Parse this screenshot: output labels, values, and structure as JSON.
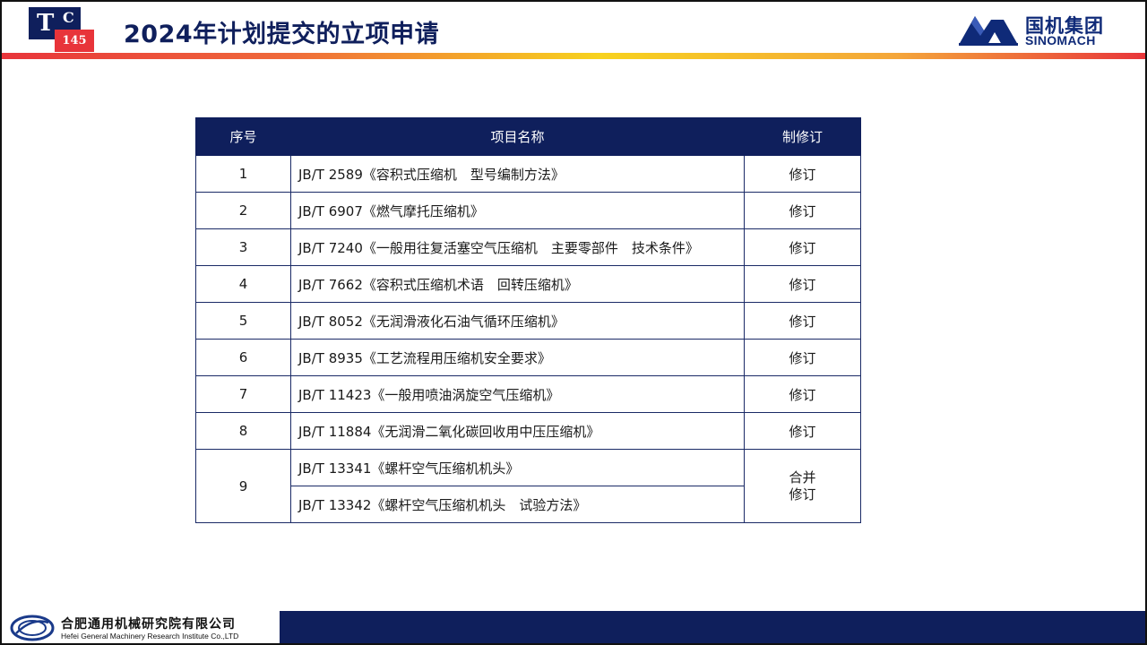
{
  "header": {
    "logo": {
      "t": "T",
      "c": "C",
      "number": "145"
    },
    "title": "2024年计划提交的立项申请",
    "brand": {
      "name_cn": "国机集团",
      "name_en": "SINOMACH"
    }
  },
  "table": {
    "headers": [
      "序号",
      "项目名称",
      "制修订"
    ],
    "rows": [
      {
        "num": "1",
        "name": "JB/T 2589《容积式压缩机　型号编制方法》",
        "status": "修订"
      },
      {
        "num": "2",
        "name": "JB/T 6907《燃气摩托压缩机》",
        "status": "修订"
      },
      {
        "num": "3",
        "name": "JB/T 7240《一般用往复活塞空气压缩机　主要零部件　技术条件》",
        "status": "修订"
      },
      {
        "num": "4",
        "name": "JB/T 7662《容积式压缩机术语　回转压缩机》",
        "status": "修订"
      },
      {
        "num": "5",
        "name": "JB/T 8052《无润滑液化石油气循环压缩机》",
        "status": "修订"
      },
      {
        "num": "6",
        "name": "JB/T 8935《工艺流程用压缩机安全要求》",
        "status": "修订"
      },
      {
        "num": "7",
        "name": "JB/T 11423《一般用喷油涡旋空气压缩机》",
        "status": "修订"
      },
      {
        "num": "8",
        "name": "JB/T 11884《无润滑二氧化碳回收用中压压缩机》",
        "status": "修订"
      }
    ],
    "merged_row": {
      "num": "9",
      "names": [
        "JB/T 13341《螺杆空气压缩机机头》",
        "JB/T 13342《螺杆空气压缩机机头　试验方法》"
      ],
      "status_line1": "合并",
      "status_line2": "修订"
    }
  },
  "footer": {
    "org_cn": "合肥通用机械研究院有限公司",
    "org_en": "Hefei General Machinery Research Institute Co.,LTD"
  },
  "colors": {
    "navy": "#0f1f5c",
    "red": "#e8343a",
    "yellow": "#f7d21e",
    "brand_blue": "#0f2a78"
  }
}
